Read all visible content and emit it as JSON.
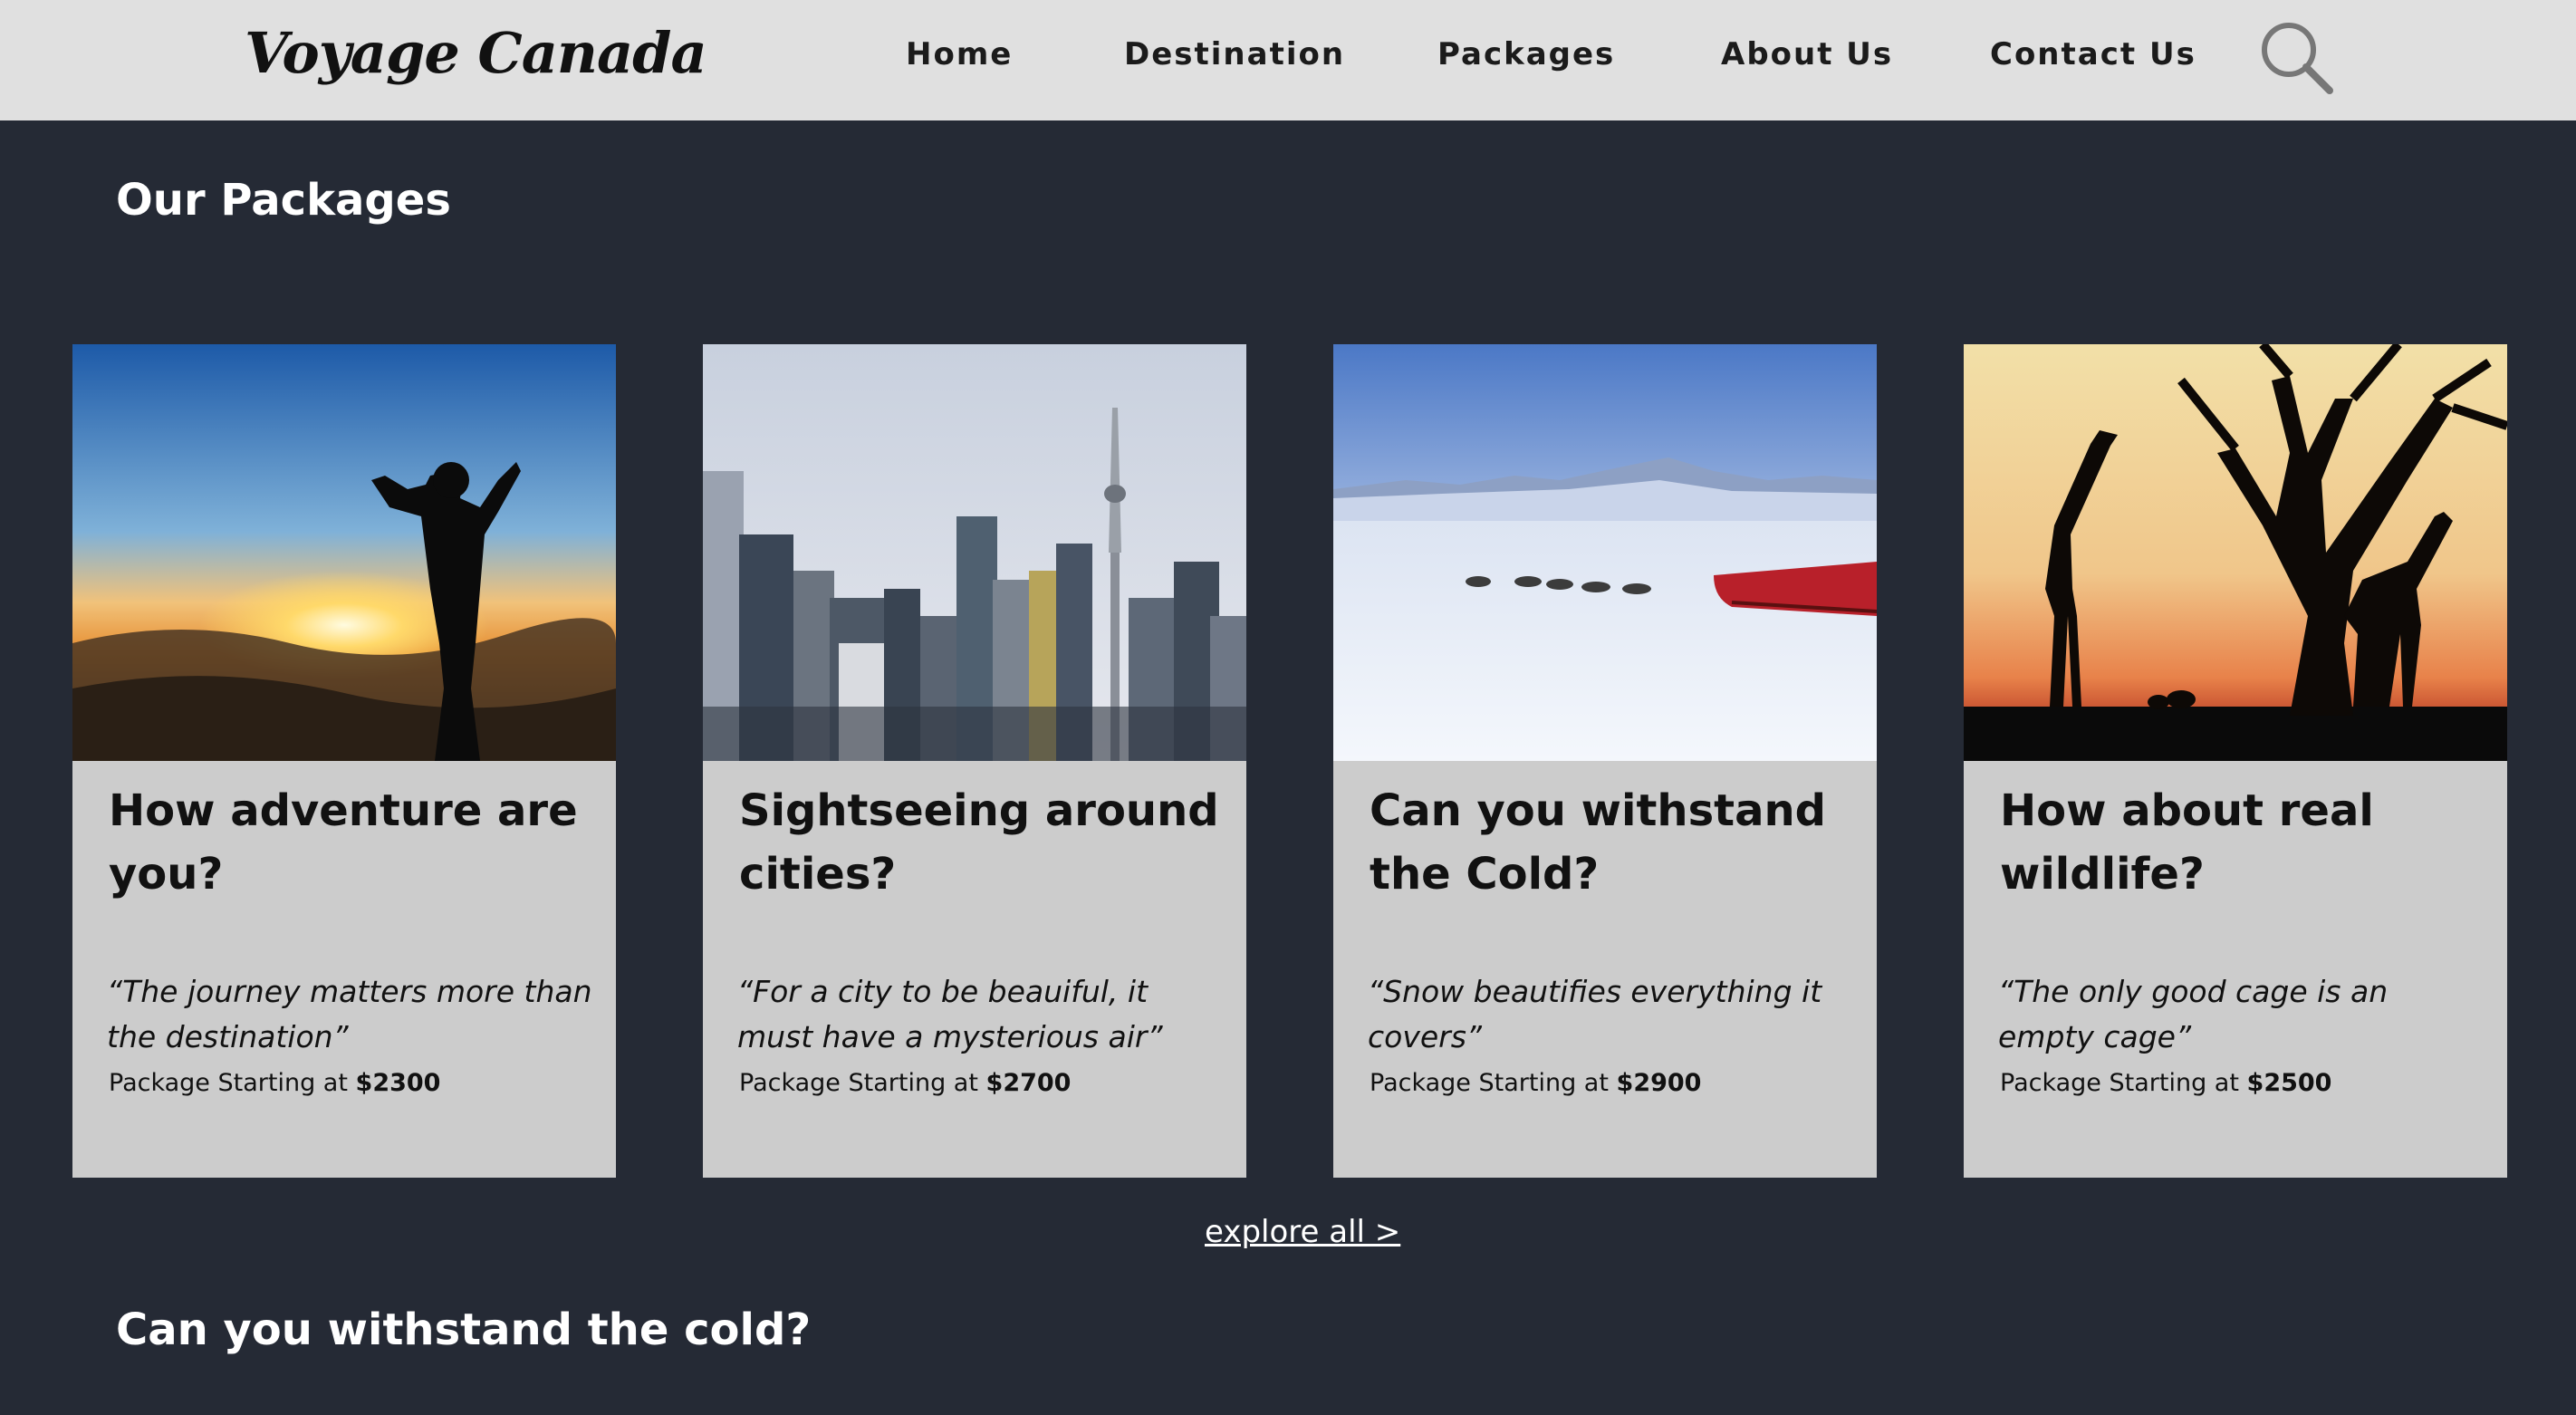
{
  "brand": {
    "logo": "Voyage Canada"
  },
  "nav": {
    "items": [
      "Home",
      "Destination",
      "Packages",
      "About Us",
      "Contact Us"
    ],
    "search_icon": "search-icon"
  },
  "packages_section": {
    "title": "Our Packages",
    "cards": [
      {
        "title": "How adventure are you?",
        "quote": "“The journey matters more than the destination”",
        "price_prefix": "Package Starting at",
        "price": "$2300",
        "image": "hiker-sunset-photo"
      },
      {
        "title": "Sightseeing around cities?",
        "quote": "“For a city to be beauiful, it must have a mysterious air”",
        "price_prefix": "Package Starting at",
        "price": "$2700",
        "image": "city-skyline-photo"
      },
      {
        "title": "Can you withstand the Cold?",
        "quote": "“Snow beautifies everything it covers”",
        "price_prefix": "Package Starting at",
        "price": "$2900",
        "image": "snow-sled-dogs-photo"
      },
      {
        "title": "How about real wildlife?",
        "quote": "“The only good cage is an empty cage”",
        "price_prefix": "Package Starting at",
        "price": "$2500",
        "image": "giraffe-silhouette-photo"
      }
    ],
    "explore_link": "explore all >"
  },
  "next_section": {
    "title": "Can you withstand the cold?"
  },
  "colors": {
    "page_bg": "#252a35",
    "nav_bg": "#e0e0e0",
    "card_bg": "#cccccc",
    "text_dark": "#111111"
  }
}
